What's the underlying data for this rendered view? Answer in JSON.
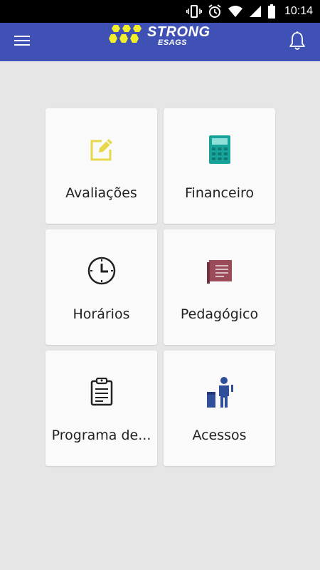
{
  "status_bar": {
    "time": "10:14",
    "icons": [
      "vibrate-icon",
      "alarm-icon",
      "wifi-icon",
      "signal-icon",
      "battery-icon"
    ]
  },
  "app_bar": {
    "background_color": "#3f51b5",
    "logo": {
      "brand": "STRONG",
      "sub": "ESAGS",
      "hex_color": "#f2ee2a"
    },
    "menu_icon": "hamburger-menu-icon",
    "notifications_icon": "bell-icon"
  },
  "tiles": [
    {
      "label": "Avaliações",
      "icon": "edit-icon",
      "icon_color": "#e6d84a"
    },
    {
      "label": "Financeiro",
      "icon": "calculator-icon",
      "icon_color": "#17a39a"
    },
    {
      "label": "Horários",
      "icon": "clock-icon",
      "icon_color": "#222222"
    },
    {
      "label": "Pedagógico",
      "icon": "book-icon",
      "icon_color": "#9a4a58"
    },
    {
      "label": "Programa de...",
      "icon": "clipboard-icon",
      "icon_color": "#222222"
    },
    {
      "label": "Acessos",
      "icon": "person-access-icon",
      "icon_color": "#2f4f9a"
    }
  ]
}
